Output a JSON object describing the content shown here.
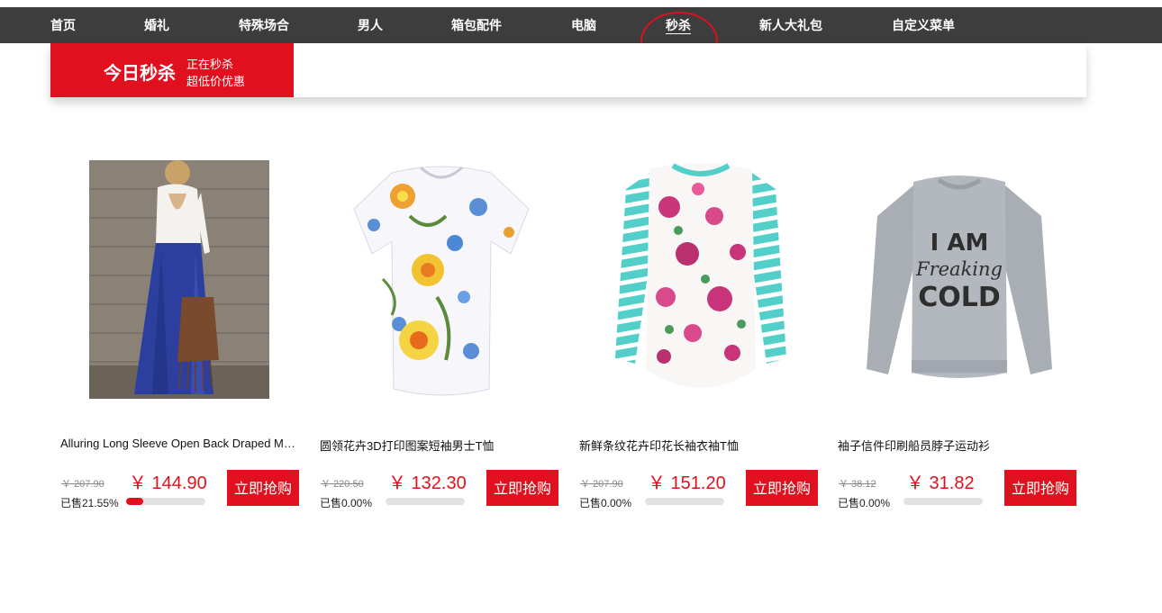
{
  "nav": {
    "items": [
      {
        "label": "首页"
      },
      {
        "label": "婚礼"
      },
      {
        "label": "特殊场合"
      },
      {
        "label": "男人"
      },
      {
        "label": "箱包配件"
      },
      {
        "label": "电脑"
      },
      {
        "label": "秒杀",
        "active": true
      },
      {
        "label": "新人大礼包"
      },
      {
        "label": "自定义菜单"
      }
    ]
  },
  "flash": {
    "title": "今日秒杀",
    "line1": "正在秒杀",
    "line2": "超低价优惠"
  },
  "buy_label": "立即抢购",
  "colors": {
    "accent": "#e0101e",
    "nav_bg": "#3d3d3d",
    "circle": "#e0101e"
  },
  "products": [
    {
      "title": "Alluring Long Sleeve Open Back Draped Maxi Dress",
      "old_price": "￥ 207.90",
      "price": "￥ 144.90",
      "sold": "已售21.55%",
      "progress": 0.2155
    },
    {
      "title": "圆领花卉3D打印图案短袖男士T恤",
      "old_price": "￥ 220.50",
      "price": "￥ 132.30",
      "sold": "已售0.00%",
      "progress": 0
    },
    {
      "title": "新鲜条纹花卉印花长袖衣袖T恤",
      "old_price": "￥ 207.90",
      "price": "￥ 151.20",
      "sold": "已售0.00%",
      "progress": 0
    },
    {
      "title": "袖子信件印刷船员脖子运动衫",
      "old_price": "￥ 38.12",
      "price": "￥ 31.82",
      "sold": "已售0.00%",
      "progress": 0,
      "image_text": [
        "I AM",
        "Freaking",
        "COLD"
      ]
    }
  ]
}
